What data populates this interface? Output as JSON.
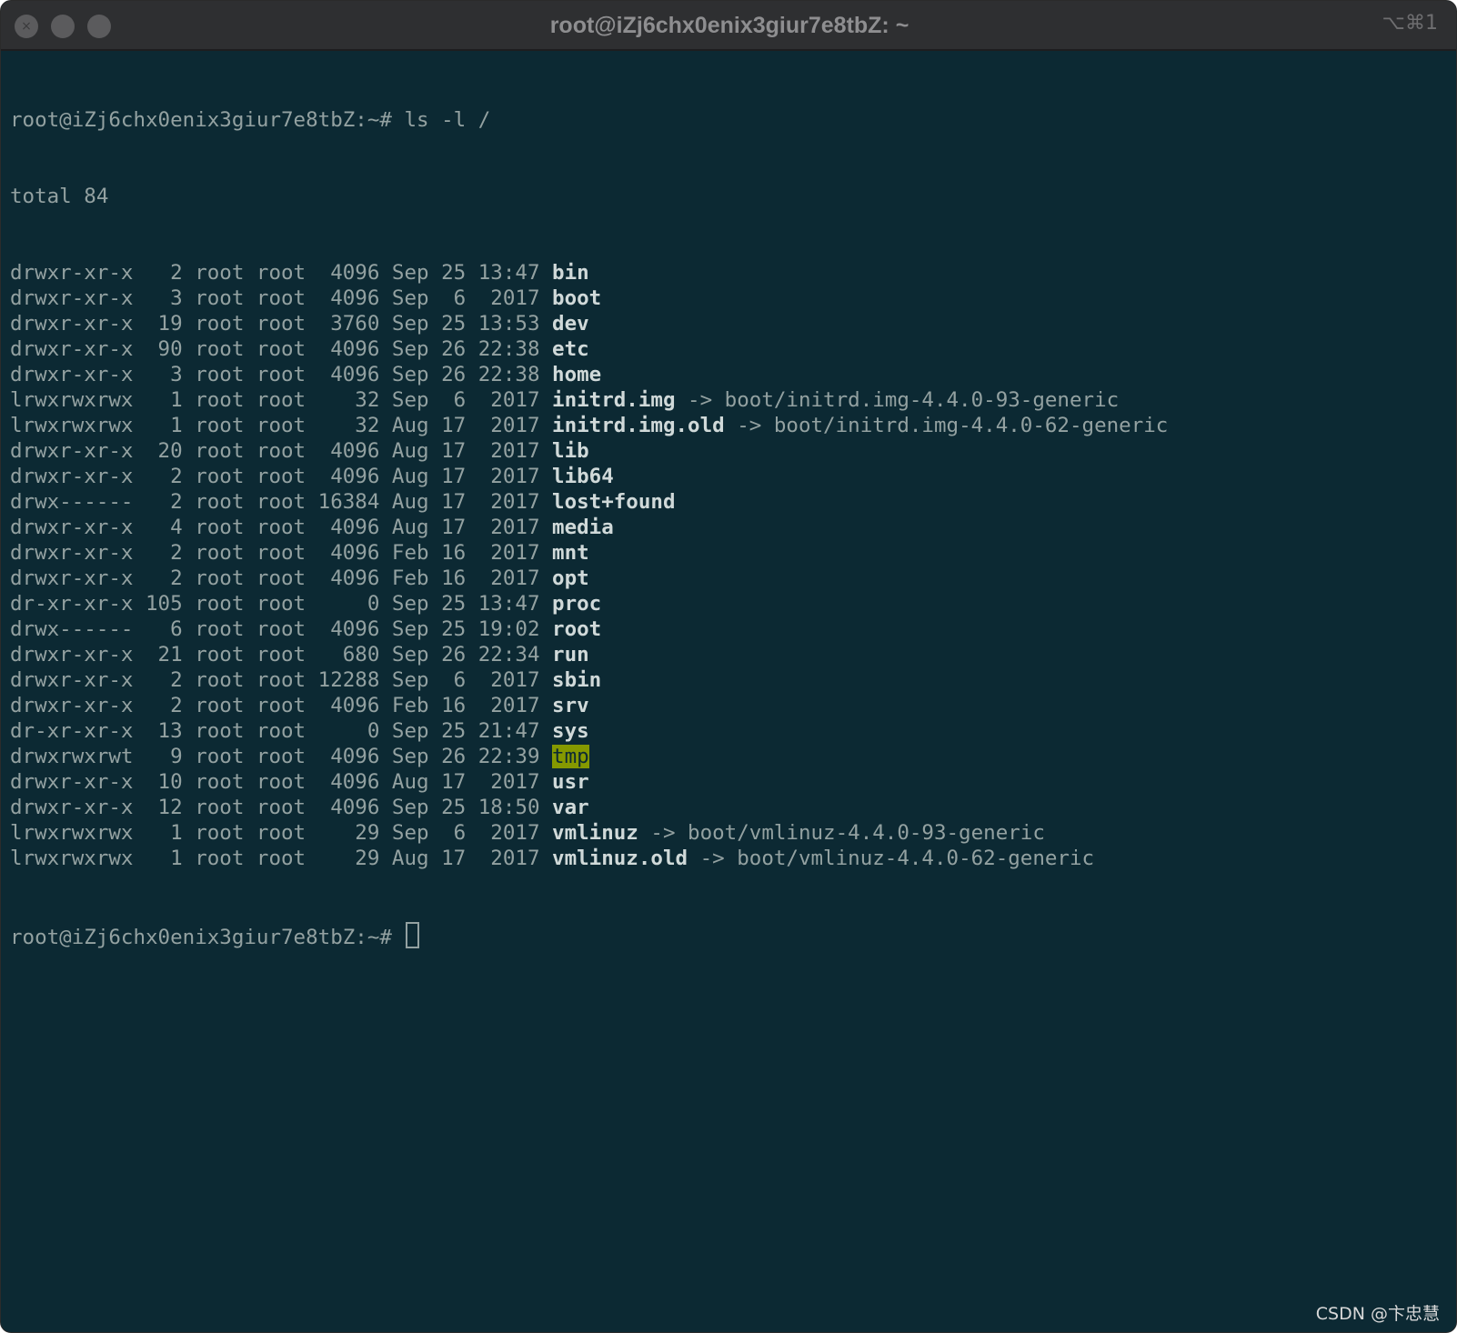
{
  "window": {
    "title": "root@iZj6chx0enix3giur7e8tbZ: ~",
    "shortcut": "⌥⌘1",
    "close_glyph": "×"
  },
  "terminal": {
    "prompt": "root@iZj6chx0enix3giur7e8tbZ:~#",
    "command": "ls -l /",
    "total": "total 84",
    "rows": [
      {
        "meta": "drwxr-xr-x   2 root root  4096 Sep 25 13:47",
        "name": "bin"
      },
      {
        "meta": "drwxr-xr-x   3 root root  4096 Sep  6  2017",
        "name": "boot"
      },
      {
        "meta": "drwxr-xr-x  19 root root  3760 Sep 25 13:53",
        "name": "dev"
      },
      {
        "meta": "drwxr-xr-x  90 root root  4096 Sep 26 22:38",
        "name": "etc"
      },
      {
        "meta": "drwxr-xr-x   3 root root  4096 Sep 26 22:38",
        "name": "home"
      },
      {
        "meta": "lrwxrwxrwx   1 root root    32 Sep  6  2017",
        "name": "initrd.img",
        "link": "-> boot/initrd.img-4.4.0-93-generic"
      },
      {
        "meta": "lrwxrwxrwx   1 root root    32 Aug 17  2017",
        "name": "initrd.img.old",
        "link": "-> boot/initrd.img-4.4.0-62-generic"
      },
      {
        "meta": "drwxr-xr-x  20 root root  4096 Aug 17  2017",
        "name": "lib"
      },
      {
        "meta": "drwxr-xr-x   2 root root  4096 Aug 17  2017",
        "name": "lib64"
      },
      {
        "meta": "drwx------   2 root root 16384 Aug 17  2017",
        "name": "lost+found"
      },
      {
        "meta": "drwxr-xr-x   4 root root  4096 Aug 17  2017",
        "name": "media"
      },
      {
        "meta": "drwxr-xr-x   2 root root  4096 Feb 16  2017",
        "name": "mnt"
      },
      {
        "meta": "drwxr-xr-x   2 root root  4096 Feb 16  2017",
        "name": "opt"
      },
      {
        "meta": "dr-xr-xr-x 105 root root     0 Sep 25 13:47",
        "name": "proc"
      },
      {
        "meta": "drwx------   6 root root  4096 Sep 25 19:02",
        "name": "root"
      },
      {
        "meta": "drwxr-xr-x  21 root root   680 Sep 26 22:34",
        "name": "run"
      },
      {
        "meta": "drwxr-xr-x   2 root root 12288 Sep  6  2017",
        "name": "sbin"
      },
      {
        "meta": "drwxr-xr-x   2 root root  4096 Feb 16  2017",
        "name": "srv"
      },
      {
        "meta": "dr-xr-xr-x  13 root root     0 Sep 25 21:47",
        "name": "sys"
      },
      {
        "meta": "drwxrwxrwt   9 root root  4096 Sep 26 22:39",
        "name": "tmp",
        "sticky": true
      },
      {
        "meta": "drwxr-xr-x  10 root root  4096 Aug 17  2017",
        "name": "usr"
      },
      {
        "meta": "drwxr-xr-x  12 root root  4096 Sep 25 18:50",
        "name": "var"
      },
      {
        "meta": "lrwxrwxrwx   1 root root    29 Sep  6  2017",
        "name": "vmlinuz",
        "link": "-> boot/vmlinuz-4.4.0-93-generic"
      },
      {
        "meta": "lrwxrwxrwx   1 root root    29 Aug 17  2017",
        "name": "vmlinuz.old",
        "link": "-> boot/vmlinuz-4.4.0-62-generic"
      }
    ]
  },
  "watermark": "CSDN @卞忠慧",
  "colors": {
    "background": "#0c2933",
    "text": "#93a1a1",
    "bold_name": "#d0d9d9",
    "sticky_highlight": "#859900",
    "titlebar": "#2e2f31"
  }
}
